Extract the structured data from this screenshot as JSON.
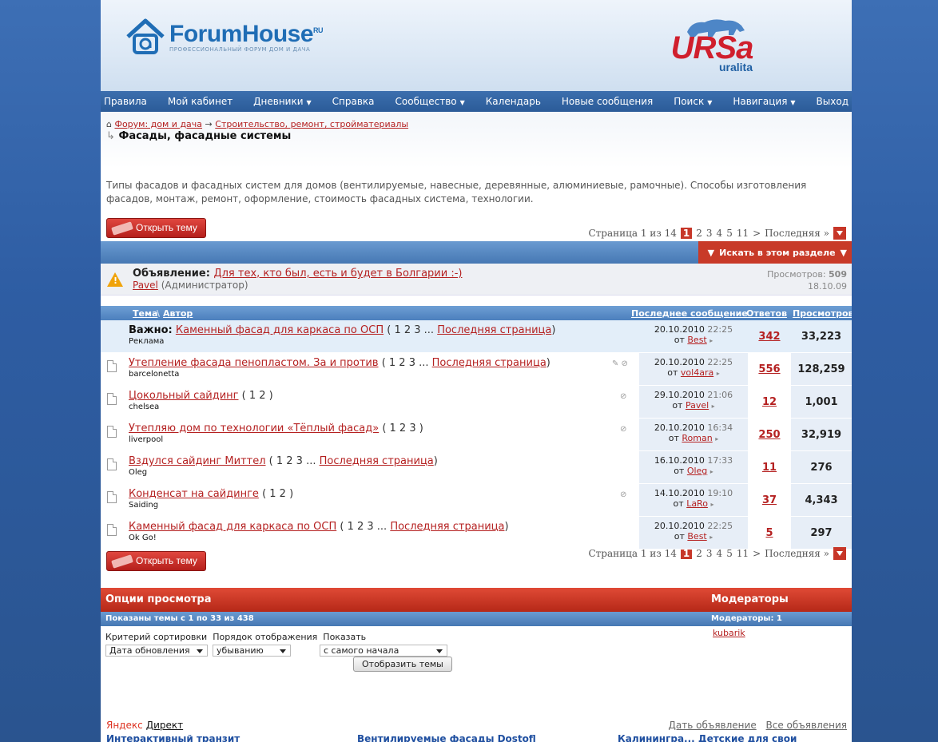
{
  "logo": {
    "brand": "ForumHouse",
    "ru": "RU",
    "tagline": "ПРОФЕССИОНАЛЬНЫЙ ФОРУМ ДОМ И ДАЧА"
  },
  "sponsor": {
    "name": "URSa",
    "sub": "uralita"
  },
  "nav": {
    "items": [
      {
        "label": "Правила",
        "dropdown": false
      },
      {
        "label": "Мой кабинет",
        "dropdown": false
      },
      {
        "label": "Дневники",
        "dropdown": true
      },
      {
        "label": "Справка",
        "dropdown": false
      },
      {
        "label": "Сообщество",
        "dropdown": true
      },
      {
        "label": "Календарь",
        "dropdown": false
      },
      {
        "label": "Новые сообщения",
        "dropdown": false
      },
      {
        "label": "Поиск",
        "dropdown": true
      },
      {
        "label": "Навигация",
        "dropdown": true
      },
      {
        "label": "Выход",
        "dropdown": false
      }
    ]
  },
  "breadcrumb": {
    "root": "Форум: дом и дача",
    "sep": "→",
    "parent": "Строительство, ремонт, стройматериалы",
    "current": "Фасады, фасадные системы"
  },
  "forum_description": "Типы фасадов и фасадных систем для домов (вентилируемые, навесные, деревянные, алюминиевые, рамочные). Способы изготовления фасадов, монтаж, ремонт, оформление, стоимость фасадных система, технологии.",
  "open_topic_label": "Открыть тему",
  "pager": {
    "summary": "Страница 1 из 14",
    "current": "1",
    "pages": [
      "2",
      "3",
      "4",
      "5",
      "11"
    ],
    "next": ">",
    "last": "Последняя »"
  },
  "search_section_label": "Искать в этом разделе",
  "announcement": {
    "prefix": "Объявление:",
    "title": "Для тех, кто был, есть и будет в Болгарии :-)",
    "author": "Pavel",
    "role": "(Администратор)",
    "views_label": "Просмотров:",
    "views": "509",
    "date": "18.10.09"
  },
  "table_headers": {
    "topic": "Тема",
    "author": "Автор",
    "last_post": "Последнее сообщение",
    "replies": "Ответов",
    "views": "Просмотров"
  },
  "threads": [
    {
      "prefix": "Важно:",
      "title": "Каменный фасад для каркаса по ОСП",
      "pages": "( 1 2 3 ...",
      "last_page": "Последняя страница",
      "close": ")",
      "author": "Реклама",
      "attach": "",
      "date": "20.10.2010",
      "time": "22:25",
      "from": "от",
      "last_user": "Best",
      "replies": "342",
      "views": "33,223",
      "sticky": true
    },
    {
      "prefix": "",
      "title": "Утепление фасада пенопластом. За и против",
      "pages": "( 1 2 3 ...",
      "last_page": "Последняя страница",
      "close": ")",
      "author": "barcelonetta",
      "attach": "✎ ⊘",
      "date": "20.10.2010",
      "time": "22:25",
      "from": "от",
      "last_user": "vol4ara",
      "replies": "556",
      "views": "128,259",
      "sticky": false
    },
    {
      "prefix": "",
      "title": "Цокольный сайдинг",
      "pages": "( 1 2 )",
      "last_page": "",
      "close": "",
      "author": "chelsea",
      "attach": "⊘",
      "date": "29.10.2010",
      "time": "21:06",
      "from": "от",
      "last_user": "Pavel",
      "replies": "12",
      "views": "1,001",
      "sticky": false
    },
    {
      "prefix": "",
      "title": "Утепляю дом по технологии «Тёплый фасад»",
      "pages": "( 1 2 3 )",
      "last_page": "",
      "close": "",
      "author": "liverpool",
      "attach": "⊘",
      "date": "20.10.2010",
      "time": "16:34",
      "from": "от",
      "last_user": "Roman",
      "replies": "250",
      "views": "32,919",
      "sticky": false
    },
    {
      "prefix": "",
      "title": "Вздулся сайдинг Миттел",
      "pages": "( 1 2 3 ...",
      "last_page": "Последняя страница",
      "close": ")",
      "author": "Oleg",
      "attach": "",
      "date": "16.10.2010",
      "time": "17:33",
      "from": "от",
      "last_user": "Oleg",
      "replies": "11",
      "views": "276",
      "sticky": false
    },
    {
      "prefix": "",
      "title": "Конденсат на сайдинге",
      "pages": "( 1 2 )",
      "last_page": "",
      "close": "",
      "author": "Saiding",
      "attach": "⊘",
      "date": "14.10.2010",
      "time": "19:10",
      "from": "от",
      "last_user": "LaRo",
      "replies": "37",
      "views": "4,343",
      "sticky": false
    },
    {
      "prefix": "",
      "title": "Каменный фасад для каркаса по ОСП",
      "pages": "( 1 2 3 ...",
      "last_page": "Последняя страница",
      "close": ")",
      "author": "Ok Go!",
      "attach": "",
      "date": "20.10.2010",
      "time": "22:25",
      "from": "от",
      "last_user": "Best",
      "replies": "5",
      "views": "297",
      "sticky": false
    }
  ],
  "options": {
    "title": "Опции просмотра",
    "subtitle": "Показаны темы с 1 по 33 из 438",
    "sort_label": "Критерий сортировки",
    "order_label": "Порядок отображения",
    "show_label": "Показать",
    "sort_value": "Дата обновления",
    "order_value": "убыванию",
    "show_value": "с самого начала",
    "submit": "Отобразить темы"
  },
  "moderators": {
    "title": "Модераторы",
    "count_label": "Модераторы: 1",
    "name": "kubarik"
  },
  "footer": {
    "yandex": "Яндекс",
    "direct": "Директ",
    "give_ad": "Дать объявление",
    "all_ads": "Все объявления",
    "cut_left": "Интерактивный транзит",
    "cut_mid": "Вентилируемые фасады Dostofl",
    "cut_right": "Калинингра... Детские для свои"
  },
  "colors": {
    "accent_red": "#c73628",
    "nav_blue": "#2b5b98",
    "link_red": "#b52121"
  }
}
